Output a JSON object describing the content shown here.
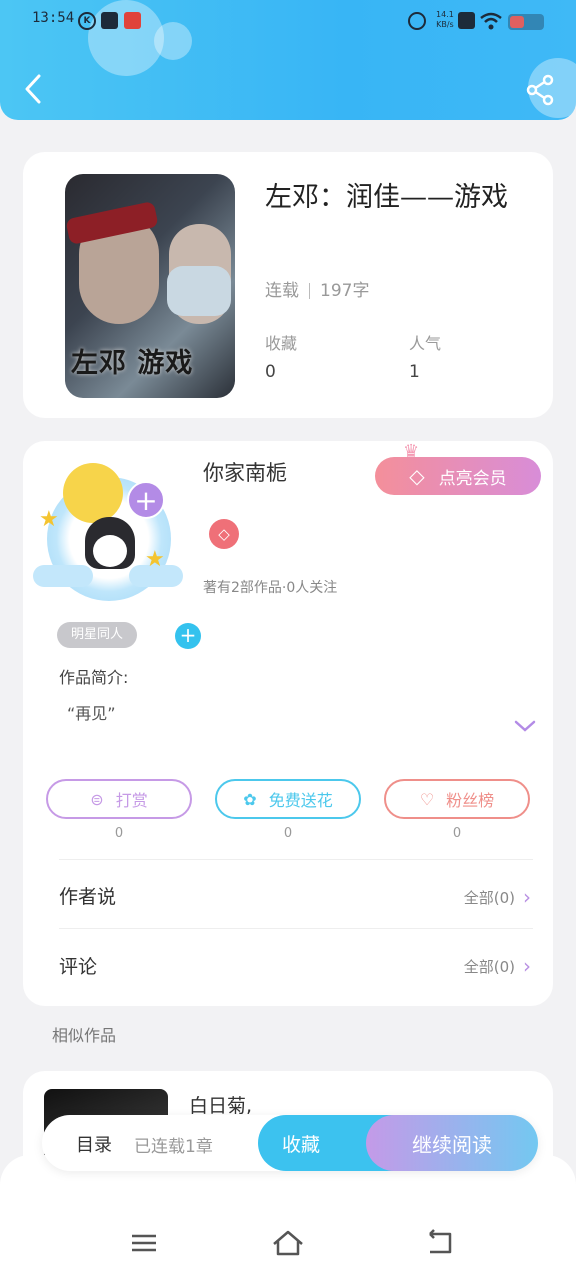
{
  "status_bar": {
    "time": "13:54",
    "network_speed_top": "14.1",
    "network_speed_bottom": "KB/s"
  },
  "header": {
    "back_icon": "chevron-left-icon",
    "share_icon": "share-icon",
    "bg_color": "#3fb9f6"
  },
  "book": {
    "cover_text": "左邓  游戏",
    "title": "左邓：润佳——游戏",
    "status": "连载",
    "word_count": "197字",
    "favorites_label": "收藏",
    "favorites_value": "0",
    "popularity_label": "人气",
    "popularity_value": "1"
  },
  "author": {
    "name": "你家南栀",
    "vip_button": "点亮会员",
    "meta": "著有2部作品·0人关注",
    "tag": "明星同人",
    "intro_label": "作品简介:",
    "intro_text": "“再见”",
    "accent_color": "#b38be6"
  },
  "actions": [
    {
      "label": "打赏",
      "icon": "yen-icon",
      "count": "0",
      "color": "#c69ae6"
    },
    {
      "label": "免费送花",
      "icon": "flower-icon",
      "count": "0",
      "color": "#4cc8ec"
    },
    {
      "label": "粉丝榜",
      "icon": "user-heart-icon",
      "count": "0",
      "color": "#ef8f8a"
    }
  ],
  "rows": {
    "author_says_label": "作者说",
    "author_says_right": "全部(0)",
    "comments_label": "评论",
    "comments_right": "全部(0)"
  },
  "similar": {
    "label": "相似作品",
    "first_title": "白日菊,"
  },
  "bottom_bar": {
    "toc_label": "目录",
    "toc_sub": "已连载1章",
    "collect_label": "收藏",
    "read_label": "继续阅读"
  },
  "nav": {
    "menu_icon": "menu-icon",
    "home_icon": "home-icon",
    "back_icon": "back-icon"
  }
}
